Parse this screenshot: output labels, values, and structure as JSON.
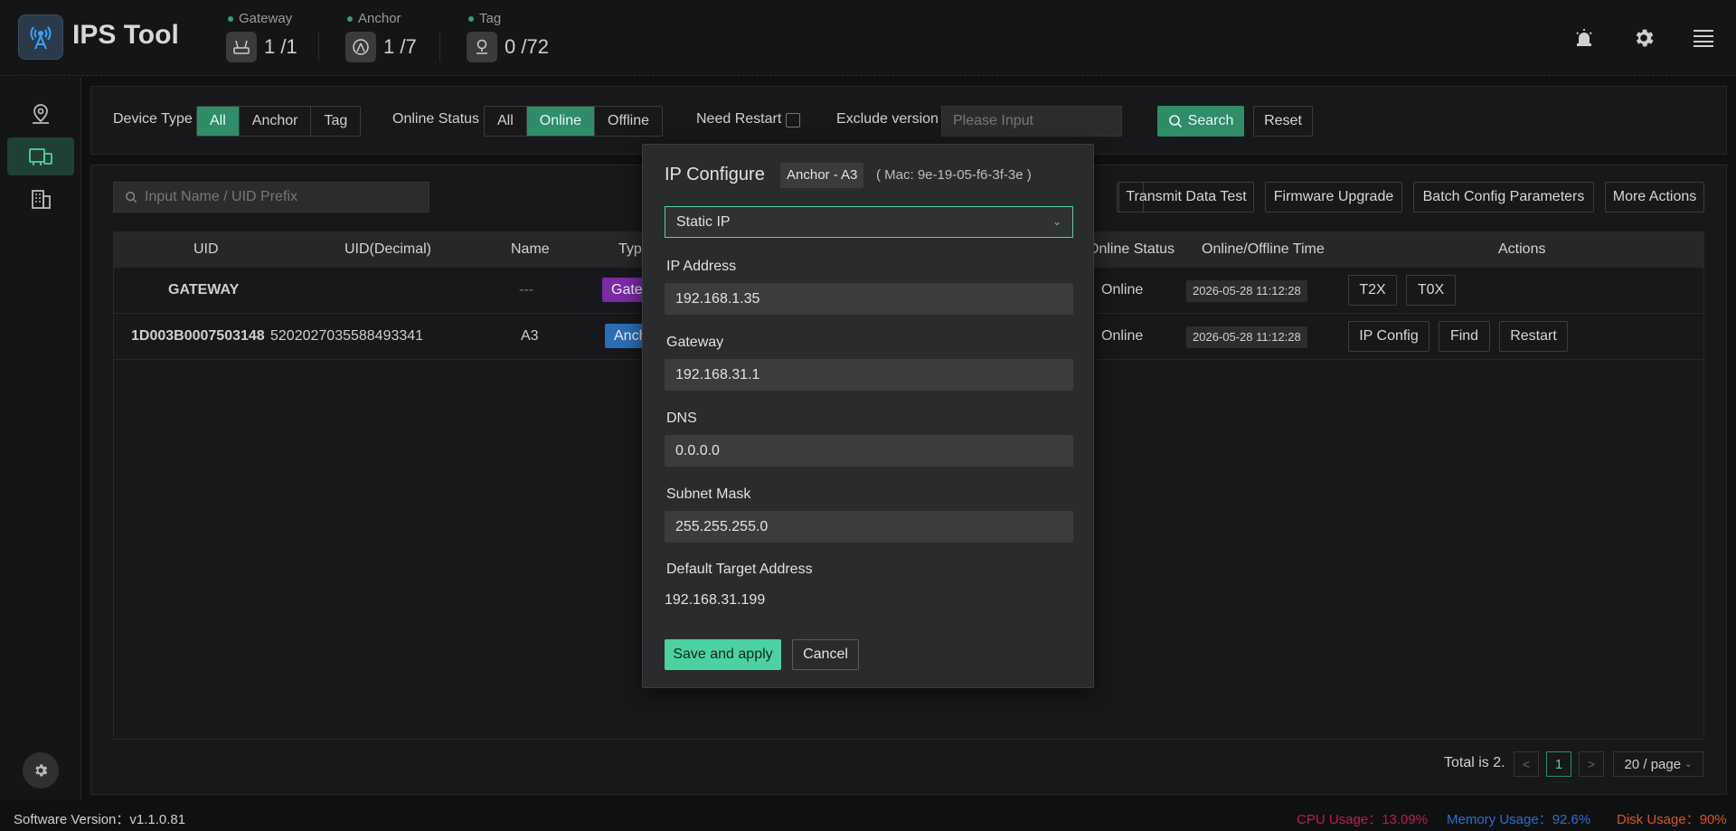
{
  "app": {
    "title": "IPS Tool"
  },
  "header": {
    "stats": [
      {
        "label": "Gateway",
        "value": "1 /1",
        "icon": "router-icon"
      },
      {
        "label": "Anchor",
        "value": "1 /7",
        "icon": "anchor-icon"
      },
      {
        "label": "Tag",
        "value": "0 /72",
        "icon": "tag-pin-icon"
      }
    ],
    "icons": [
      "alarm-icon",
      "gear-icon",
      "menu-icon"
    ]
  },
  "sidebar": {
    "items": [
      "map-pin-icon",
      "devices-icon",
      "building-icon"
    ],
    "bottom_icon": "settings-icon"
  },
  "filter": {
    "device_type_label": "Device Type",
    "device_type_options": [
      "All",
      "Anchor",
      "Tag"
    ],
    "device_type_selected": "All",
    "online_status_label": "Online Status",
    "online_status_options": [
      "All",
      "Online",
      "Offline"
    ],
    "online_status_selected": "Online",
    "need_restart_label": "Need Restart",
    "exclude_version_label": "Exclude version",
    "exclude_version_placeholder": "Please Input",
    "search_label": "Search",
    "reset_label": "Reset"
  },
  "toolbar": {
    "search_placeholder": "Input Name / UID Prefix",
    "buttons": [
      "Transmit Data Test",
      "Firmware Upgrade",
      "Batch Config Parameters",
      "More Actions"
    ]
  },
  "table": {
    "headers": [
      "UID",
      "UID(Decimal)",
      "Name",
      "Type",
      "Online Status",
      "Online/Offline Time",
      "Actions"
    ],
    "rows": [
      {
        "uid": "GATEWAY",
        "uid_decimal": "",
        "name": "---",
        "type": "Gatew",
        "type_color": "#7b2aa8",
        "status": "Online",
        "time": "2026-05-28 11:12:28",
        "actions": [
          "T2X",
          "T0X"
        ]
      },
      {
        "uid": "1D003B0007503148",
        "uid_decimal": "5202027035588493341",
        "name": "A3",
        "type": "Anch",
        "type_color": "#2a6fb5",
        "status": "Online",
        "time": "2026-05-28 11:12:28",
        "actions": [
          "IP Config",
          "Find",
          "Restart"
        ]
      }
    ]
  },
  "pagination": {
    "total": "Total is 2.",
    "current_page": "1",
    "page_size": "20 / page",
    "prev": "<",
    "next": ">"
  },
  "footer": {
    "software_version": "Software Version：v1.1.0.81",
    "cpu": "CPU Usage：13.09%",
    "memory": "Memory Usage：92.6%",
    "disk": "Disk Usage：90%",
    "cpu_color": "#c2185b",
    "memory_color": "#2a6fd0",
    "disk_color": "#d9541e"
  },
  "modal": {
    "title": "IP Configure",
    "device_chip": "Anchor - A3",
    "mac": "( Mac: 9e-19-05-f6-3f-3e )",
    "mode": "Static IP",
    "ip_label": "IP Address",
    "ip_value": "192.168.1.35",
    "gateway_label": "Gateway",
    "gateway_value": "192.168.31.1",
    "dns_label": "DNS",
    "dns_value": "0.0.0.0",
    "subnet_label": "Subnet Mask",
    "subnet_value": "255.255.255.0",
    "target_label": "Default Target Address",
    "target_value": "192.168.31.199",
    "save_label": "Save and apply",
    "cancel_label": "Cancel"
  },
  "colors": {
    "accent": "#2f8d67",
    "accent_light": "#4cd29f"
  }
}
